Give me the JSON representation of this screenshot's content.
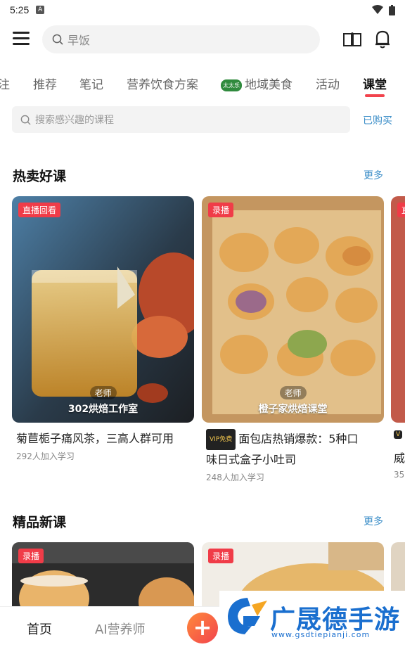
{
  "status_bar": {
    "time": "5:25",
    "a_label": "A"
  },
  "header": {
    "search_placeholder": "早饭"
  },
  "tabs": [
    {
      "label": "注"
    },
    {
      "label": "推荐"
    },
    {
      "label": "笔记"
    },
    {
      "label": "营养饮食方案"
    },
    {
      "label": "地域美食",
      "badge": "太太乐"
    },
    {
      "label": "活动"
    },
    {
      "label": "课堂",
      "active": true
    }
  ],
  "course_search": {
    "placeholder": "搜索感兴趣的课程",
    "purchased_label": "已购买"
  },
  "hot_section": {
    "title": "热卖好课",
    "more": "更多",
    "cards": [
      {
        "tag": "直播回看",
        "teacher_badge": "老师",
        "teacher_name": "302烘焙工作室",
        "title": "菊苣栀子痛风茶，三高人群可用",
        "learners": "292人加入学习"
      },
      {
        "tag": "录播",
        "teacher_badge": "老师",
        "teacher_name": "橙子家烘焙课堂",
        "vip": "VIP免费",
        "title_line1": "面包店热销爆款：5种口",
        "title_line2": "味日式盒子小吐司",
        "learners": "248人加入学习"
      }
    ],
    "partial": {
      "tag": "直",
      "vip": "V",
      "title": "威",
      "learners": "35"
    }
  },
  "new_section": {
    "title": "精品新课",
    "more": "更多",
    "cards": [
      {
        "tag": "录播"
      },
      {
        "tag": "录播"
      }
    ]
  },
  "bottom_nav": {
    "home": "首页",
    "ai": "AI营养师",
    "plus": "+"
  },
  "watermark": {
    "text": "广晟德手游",
    "url": "www.gsdtiepianji.com"
  },
  "colors": {
    "accent": "#f2434d",
    "link": "#3b8ec8"
  }
}
